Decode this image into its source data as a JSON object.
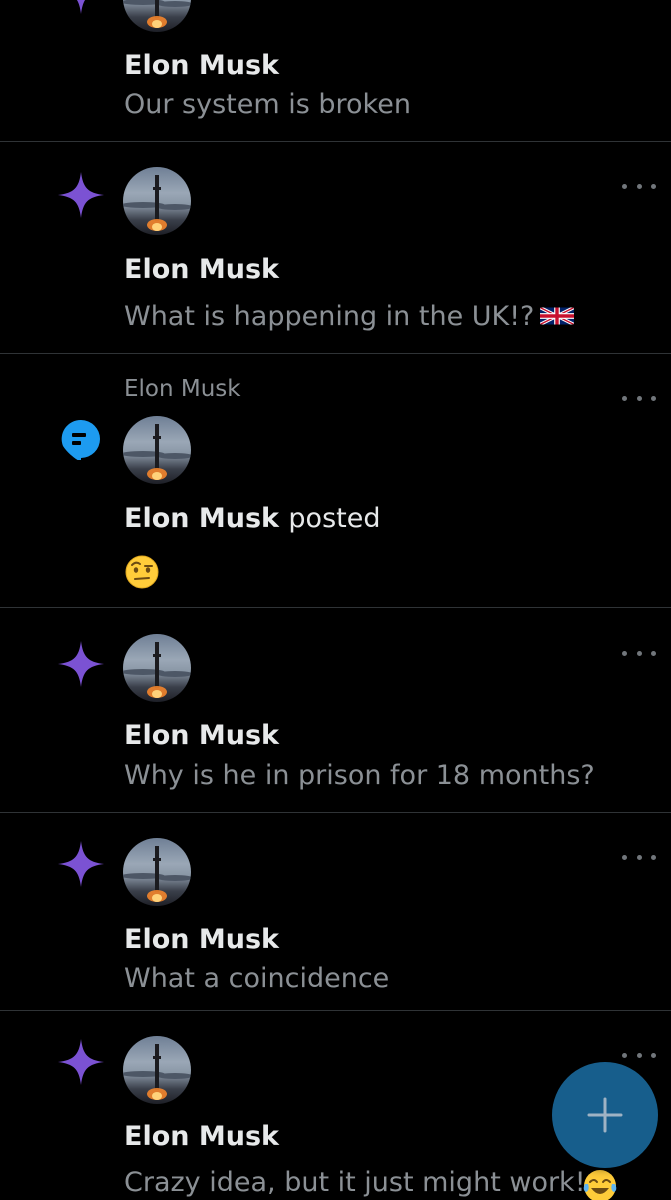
{
  "colors": {
    "background": "#000000",
    "divider": "#2f3336",
    "name_text": "#e7e9ea",
    "body_text": "#8b9095",
    "sparkle": "#7b52d3",
    "bubble": "#1d9bf0",
    "fab": "#175e8c"
  },
  "feed": {
    "items": [
      {
        "type": "recommended",
        "icon": "sparkle-icon",
        "author": "Elon Musk",
        "text": "Our system is broken"
      },
      {
        "type": "recommended",
        "icon": "sparkle-icon",
        "author": "Elon Musk",
        "text": "What is happening in the UK!?",
        "emoji": "uk-flag"
      },
      {
        "type": "post-notification",
        "icon": "message-bubble-icon",
        "social_context": "Elon Musk",
        "author": "Elon Musk",
        "posted_label": "posted",
        "emoji": "raised-eyebrow-face"
      },
      {
        "type": "recommended",
        "icon": "sparkle-icon",
        "author": "Elon Musk",
        "text": "Why is he in prison for 18 months?"
      },
      {
        "type": "recommended",
        "icon": "sparkle-icon",
        "author": "Elon Musk",
        "text": "What a coincidence"
      },
      {
        "type": "recommended",
        "icon": "sparkle-icon",
        "author": "Elon Musk",
        "text": "Crazy idea, but it just might work!",
        "emoji": "tears-of-joy-face"
      }
    ]
  },
  "fab": {
    "icon": "plus-icon"
  }
}
